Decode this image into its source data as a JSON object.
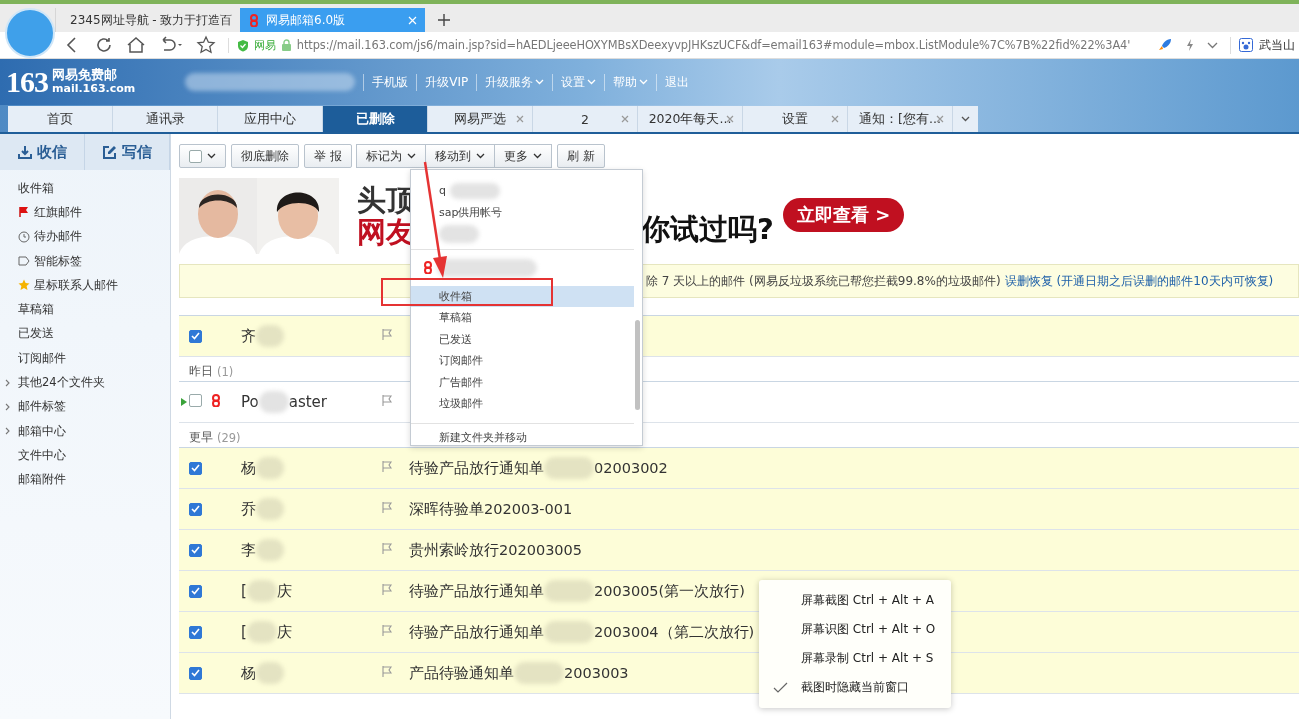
{
  "browser": {
    "tabs": [
      {
        "title": "2345网址导航 - 致力于打造百",
        "selected": false
      },
      {
        "title": "网易邮箱6.0版",
        "selected": true
      }
    ],
    "address": {
      "badge": "网易",
      "url": "https://mail.163.com/js6/main.jsp?sid=hAEDLjeeeHOXYMBsXDeexyvpJHKszUCF&df=email163#module=mbox.ListModule%7C%7B%22fid%22%3A4'",
      "bookmark": "武当山"
    }
  },
  "header": {
    "logo_number": "163",
    "logo_name": "网易免费邮",
    "logo_domain": "mail.163.com",
    "links": [
      {
        "label": "手机版",
        "dropdown": false
      },
      {
        "label": "升级VIP",
        "dropdown": false
      },
      {
        "label": "升级服务",
        "dropdown": true
      },
      {
        "label": "设置",
        "dropdown": true
      },
      {
        "label": "帮助",
        "dropdown": true
      },
      {
        "label": "退出",
        "dropdown": false
      }
    ]
  },
  "tabs": [
    {
      "label": "首页",
      "selected": false,
      "closable": false
    },
    {
      "label": "通讯录",
      "selected": false,
      "closable": false
    },
    {
      "label": "应用中心",
      "selected": false,
      "closable": false
    },
    {
      "label": "已删除",
      "selected": true,
      "closable": false
    },
    {
      "label": "网易严选",
      "selected": false,
      "closable": true
    },
    {
      "label": "2",
      "selected": false,
      "closable": true
    },
    {
      "label": "2020年每天...",
      "selected": false,
      "closable": true
    },
    {
      "label": "设置",
      "selected": false,
      "closable": true
    },
    {
      "label": "通知：[您有...",
      "selected": false,
      "closable": true
    }
  ],
  "sidebar": {
    "receive": "收信",
    "compose": "写信",
    "folders": [
      {
        "label": "收件箱",
        "kind": "plain"
      },
      {
        "label": "红旗邮件",
        "kind": "flag"
      },
      {
        "label": "待办邮件",
        "kind": "clock"
      },
      {
        "label": "智能标签",
        "kind": "tag"
      },
      {
        "label": "星标联系人邮件",
        "kind": "star"
      },
      {
        "label": "草稿箱",
        "kind": "plain"
      },
      {
        "label": "已发送",
        "kind": "plain"
      },
      {
        "label": "订阅邮件",
        "kind": "plain"
      },
      {
        "label": "其他24个文件夹",
        "kind": "group"
      },
      {
        "label": "邮件标签",
        "kind": "group"
      },
      {
        "label": "邮箱中心",
        "kind": "group"
      },
      {
        "label": "文件中心",
        "kind": "plain"
      },
      {
        "label": "邮箱附件",
        "kind": "plain"
      }
    ]
  },
  "toolbar": {
    "select_all": {
      "checked": false
    },
    "buttons": [
      {
        "label": "彻底删除",
        "dropdown": false,
        "group": false
      },
      {
        "label": "举 报",
        "dropdown": false,
        "group": false
      },
      {
        "label": "标记为",
        "dropdown": true,
        "group": true
      },
      {
        "label": "移动到",
        "dropdown": true,
        "group": true
      },
      {
        "label": "更多",
        "dropdown": true,
        "group": true
      },
      {
        "label": "刷 新",
        "dropdown": false,
        "group": false
      }
    ]
  },
  "ad": {
    "headline_top": "头顶",
    "headline_bottom": "网友",
    "question": "你试过吗?",
    "cta": "立即查看 >"
  },
  "notice": {
    "text": "除 7 天以上的邮件 (网易反垃圾系统已帮您拦截99.8%的垃圾邮件)",
    "link": "误删恢复",
    "note": "(开通日期之后误删的邮件10天内可恢复)"
  },
  "mail_list": [
    {
      "kind": "mail",
      "checked": true,
      "unread": false,
      "sender": "齐"
    },
    {
      "kind": "group",
      "label": "昨日",
      "count": "(1)"
    },
    {
      "kind": "mail",
      "checked": false,
      "unread": true,
      "sender": "Po",
      "sender_end": "aster"
    },
    {
      "kind": "group",
      "label": "更早",
      "count": "(29)"
    },
    {
      "kind": "mail",
      "checked": true,
      "unread": false,
      "sender": "杨",
      "subject": "待验产品放行通知单",
      "subject_end": "02003002"
    },
    {
      "kind": "mail",
      "checked": true,
      "unread": false,
      "sender": "乔",
      "subject": "深晖待验单202003-001"
    },
    {
      "kind": "mail",
      "checked": true,
      "unread": false,
      "sender": "李",
      "subject": "贵州索岭放行202003005"
    },
    {
      "kind": "mail",
      "checked": true,
      "unread": false,
      "sender": "[",
      "sender_end": "庆",
      "subject": "待验产品放行通知单",
      "subject_end": "2003005(第一次放行)"
    },
    {
      "kind": "mail",
      "checked": true,
      "unread": false,
      "sender": "[",
      "sender_end": "庆",
      "subject": "待验产品放行通知单",
      "subject_end": "2003004（第二次放行)"
    },
    {
      "kind": "mail",
      "checked": true,
      "unread": false,
      "sender": "杨",
      "subject": "产品待验通知单",
      "subject_end": "2003003"
    }
  ],
  "move_menu": {
    "items": [
      {
        "kind": "account",
        "label": "q"
      },
      {
        "kind": "account",
        "label": "sap供用帐号"
      },
      {
        "kind": "mailbox"
      },
      {
        "kind": "folder",
        "label": "收件箱",
        "selected": true
      },
      {
        "kind": "folder",
        "label": "草稿箱",
        "selected": false
      },
      {
        "kind": "folder",
        "label": "已发送",
        "selected": false
      },
      {
        "kind": "folder",
        "label": "订阅邮件",
        "selected": false
      },
      {
        "kind": "folder",
        "label": "广告邮件",
        "selected": false
      },
      {
        "kind": "folder",
        "label": "垃圾邮件",
        "selected": false
      },
      {
        "kind": "action",
        "label": "新建文件夹并移动"
      }
    ]
  },
  "context_menu": {
    "items": [
      {
        "label": "屏幕截图",
        "shortcut": "Ctrl + Alt + A",
        "checked": false
      },
      {
        "label": "屏幕识图",
        "shortcut": "Ctrl + Alt + O",
        "checked": false
      },
      {
        "label": "屏幕录制",
        "shortcut": "Ctrl + Alt + S",
        "checked": false
      },
      {
        "label": "截图时隐藏当前窗口",
        "checked": true
      }
    ]
  }
}
